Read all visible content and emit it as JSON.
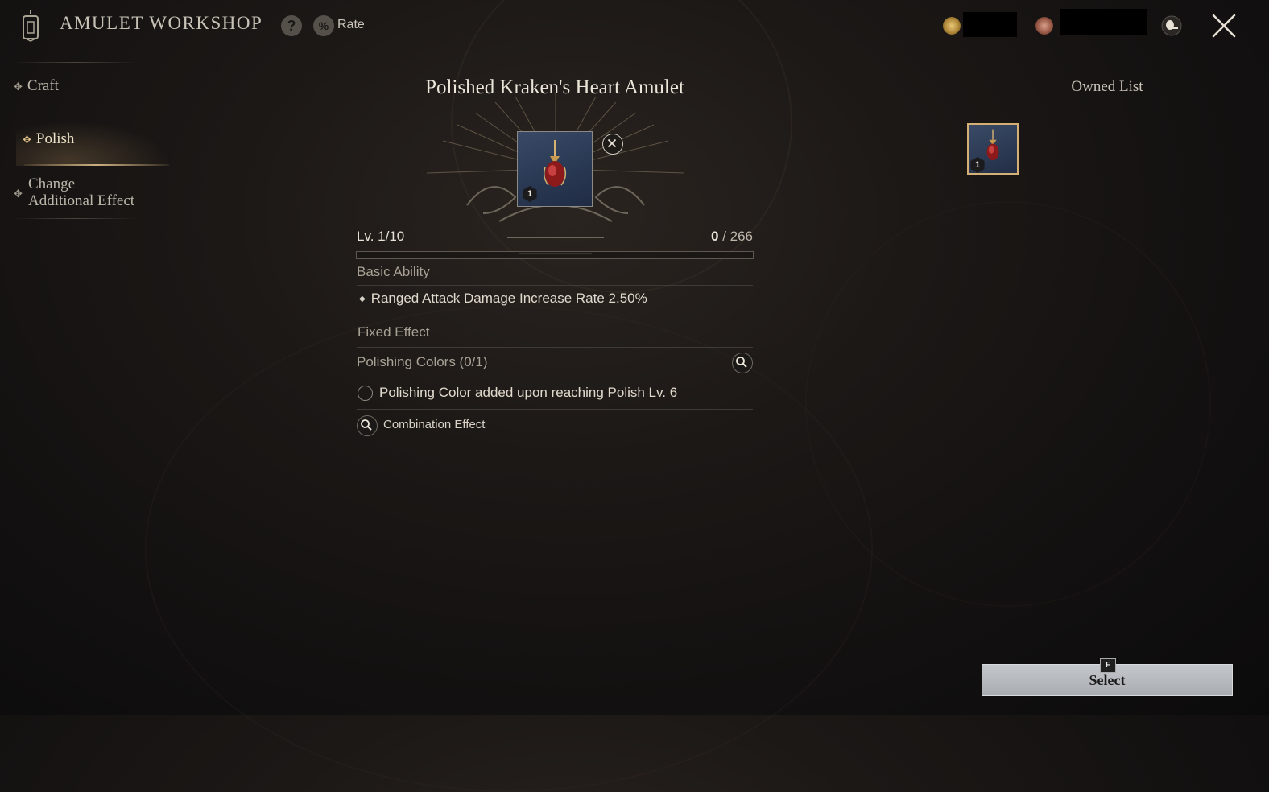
{
  "header": {
    "title": "AMULET WORKSHOP",
    "help_icon": "question-icon",
    "rate_icon": "percent-icon",
    "rate_label": "Rate"
  },
  "currencies": [
    {
      "icon": "gold-coin-icon",
      "value": ""
    },
    {
      "icon": "bronze-coin-icon",
      "value": ""
    }
  ],
  "sidebar": {
    "items": [
      {
        "label": "Craft",
        "active": false
      },
      {
        "label": "Polish",
        "active": true
      },
      {
        "label": "Change Additional Effect",
        "active": false
      }
    ],
    "change_line1": "Change",
    "change_line2": "Additional Effect"
  },
  "item": {
    "name": "Polished Kraken's Heart Amulet",
    "slot_level": "1",
    "level_text": "Lv. 1/10",
    "xp_current": "0",
    "xp_max": "/ 266",
    "xp_progress": 0
  },
  "sections": {
    "basic_ability": "Basic Ability",
    "basic_effect": "Ranged Attack Damage Increase Rate 2.50%",
    "fixed_effect": "Fixed Effect",
    "polishing_colors": "Polishing Colors (0/1)",
    "polishing_note": "Polishing Color added upon reaching Polish Lv. 6",
    "combination_effect": "Combination Effect"
  },
  "owned_list": {
    "title": "Owned List",
    "items": [
      {
        "level": "1"
      }
    ]
  },
  "footer": {
    "key": "F",
    "select_label": "Select"
  },
  "colors": {
    "accent_gold": "#d4b074",
    "button_silver": "#b4b8bc",
    "item_blue": "#2b3a55"
  }
}
